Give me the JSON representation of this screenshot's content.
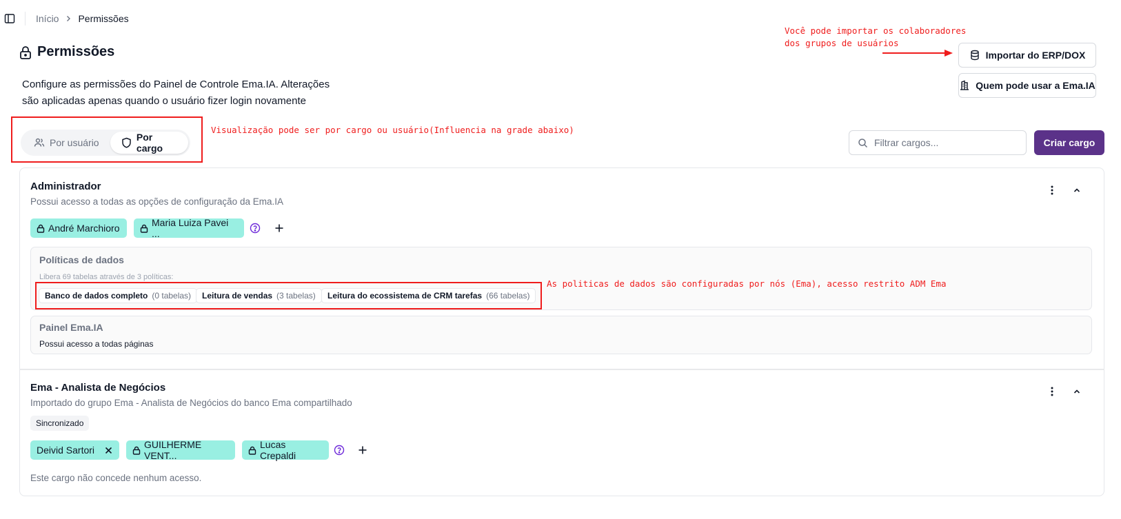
{
  "breadcrumb": {
    "home": "Início",
    "current": "Permissões"
  },
  "header": {
    "title": "Permissões",
    "description_line1": "Configure as permissões do Painel de Controle Ema.IA. Alterações",
    "description_line2": "são aplicadas apenas quando o usuário fizer login novamente"
  },
  "actions": {
    "import_label": "Importar do ERP/DOX",
    "who_label": "Quem pode usar a Ema.IA"
  },
  "view_toggle": {
    "by_user": "Por usuário",
    "by_role": "Por cargo",
    "selected": "Por cargo"
  },
  "search": {
    "placeholder": "Filtrar cargos...",
    "value": ""
  },
  "create_label": "Criar cargo",
  "roles": [
    {
      "name": "Administrador",
      "description": "Possui acesso a todas as opções de configuração da Ema.IA",
      "members": [
        "André Marchioro",
        "Maria Luiza Pavei ..."
      ],
      "data_policies": {
        "title": "Políticas de dados",
        "summary": "Libera 69 tabelas através de 3 políticas:",
        "policies": [
          {
            "name": "Banco de dados completo",
            "count": "(0 tabelas)"
          },
          {
            "name": "Leitura de vendas",
            "count": "(3 tabelas)"
          },
          {
            "name": "Leitura do ecossistema de CRM tarefas",
            "count": "(66 tabelas)"
          }
        ]
      },
      "panel": {
        "title": "Painel Ema.IA",
        "text": "Possui acesso a todas páginas"
      }
    },
    {
      "name": "Ema - Analista de Negócios",
      "description": "Importado do grupo Ema - Analista de Negócios do banco Ema compartilhado",
      "badge": "Sincronizado",
      "members": [
        "Deivid Sartori",
        "GUILHERME VENT...",
        "Lucas Crepaldi"
      ],
      "no_access": "Este cargo não concede nenhum acesso."
    }
  ],
  "annotations": {
    "import_note_line1": "Você pode importar os colaboradores",
    "import_note_line2": "dos grupos de usuários",
    "view_note": "Visualização pode ser por cargo ou usuário(Influencia na grade abaixo)",
    "policy_note": "As politicas de dados são configuradas por nós (Ema), acesso restrito ADM Ema"
  },
  "colors": {
    "primary": "#5b3289",
    "chip": "#99efe2",
    "annotation": "#ef1c1c",
    "help_icon": "#6d28d9"
  }
}
